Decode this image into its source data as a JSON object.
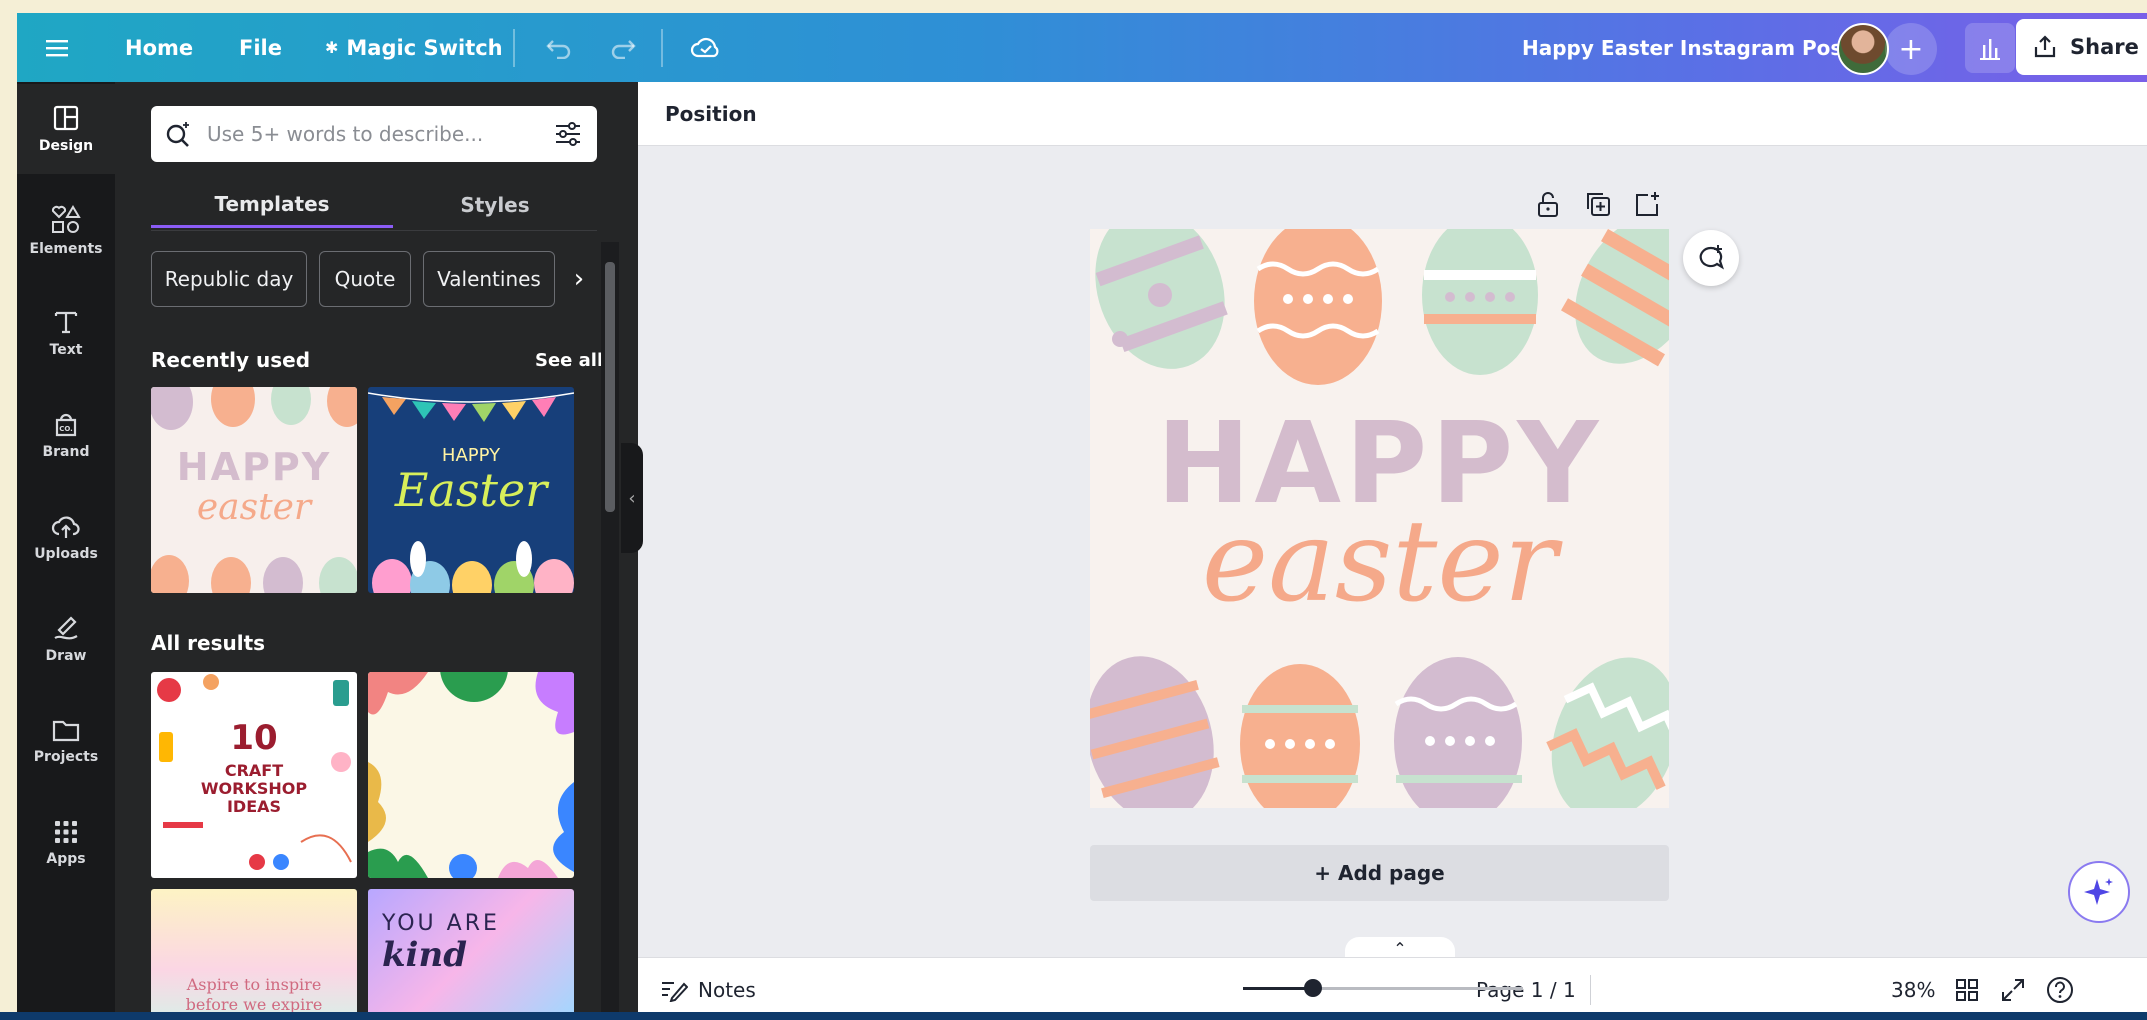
{
  "topbar": {
    "home": "Home",
    "file": "File",
    "magic_switch": "Magic Switch",
    "doc_title": "Happy Easter Instagram Post",
    "share": "Share"
  },
  "rail": [
    {
      "label": "Design",
      "icon": "layout-icon"
    },
    {
      "label": "Elements",
      "icon": "shapes-icon"
    },
    {
      "label": "Text",
      "icon": "text-icon"
    },
    {
      "label": "Brand",
      "icon": "brand-icon"
    },
    {
      "label": "Uploads",
      "icon": "upload-cloud-icon"
    },
    {
      "label": "Draw",
      "icon": "pen-icon"
    },
    {
      "label": "Projects",
      "icon": "folder-icon"
    },
    {
      "label": "Apps",
      "icon": "grid-icon"
    }
  ],
  "panel": {
    "search_placeholder": "Use 5+ words to describe...",
    "tabs": [
      "Templates",
      "Styles"
    ],
    "chips": [
      "Republic day",
      "Quote",
      "Valentines"
    ],
    "recently_used": "Recently used",
    "see_all": "See all",
    "all_results": "All results",
    "thumbs": {
      "happy": "HAPPY",
      "easter": "easter",
      "happy_small": "HAPPY",
      "easter_script": "Easter",
      "craft_num": "10",
      "craft_l1": "CRAFT",
      "craft_l2": "WORKSHOP",
      "craft_l3": "IDEAS",
      "aspire_l1": "Aspire to inspire",
      "aspire_l2": "before we expire",
      "kind_l1": "YOU ARE",
      "kind_l2": "kind"
    }
  },
  "canvas": {
    "position_label": "Position",
    "art_happy": "HAPPY",
    "art_easter": "easter",
    "add_page": "+ Add page"
  },
  "bottombar": {
    "notes": "Notes",
    "page": "Page 1 / 1",
    "zoom": "38%",
    "zoom_value": 0.38
  },
  "colors": {
    "accent": "#8b5cf6",
    "egg_pink": "#f7b08f",
    "egg_mint": "#c7e2cf",
    "egg_lilac": "#d3bcd0",
    "happy_text": "#d4bccd",
    "easter_text": "#f5a98a"
  }
}
